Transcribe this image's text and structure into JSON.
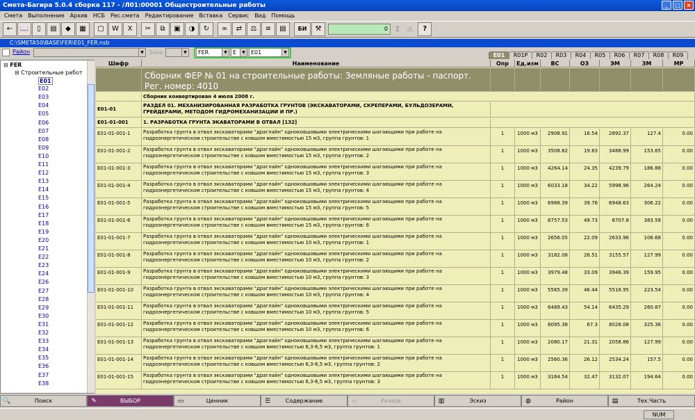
{
  "window": {
    "title": "Смета-Багира 5.0.4 сборка 117     -     /Л01:00001 Общестроительные работы"
  },
  "menu": [
    "Смета",
    "Выполнение",
    "Архив",
    "НСБ",
    "Рес.смета",
    "Редактирование",
    "Вставка",
    "Сервис",
    "Вид",
    "Помощь"
  ],
  "toolbar": {
    "bi_label": "БИ",
    "value": "0",
    "sigma": "Σ",
    "warn": "⚠"
  },
  "path": "C:\\SMETA50\\BASE\\FER\\E01_FER.nsb",
  "filters": {
    "raion": "Район",
    "zona": "Зона",
    "base": "FER",
    "letter": "E",
    "collection": "E01"
  },
  "tabs": [
    "E01",
    "R01P",
    "R02",
    "R03",
    "R04",
    "R05",
    "R06",
    "R07",
    "R08",
    "R09"
  ],
  "tree": {
    "root": "FER",
    "group": "Строительные работ",
    "codes": [
      "E01",
      "E02",
      "E03",
      "E04",
      "E05",
      "E06",
      "E07",
      "E08",
      "E09",
      "E10",
      "E11",
      "E12",
      "E13",
      "E14",
      "E15",
      "E16",
      "E17",
      "E18",
      "E19",
      "E20",
      "E21",
      "E22",
      "E23",
      "E24",
      "E26",
      "E27",
      "E28",
      "E29",
      "E30",
      "E31",
      "E32",
      "E33",
      "E34",
      "E35",
      "E36",
      "E37",
      "E38"
    ]
  },
  "columns": {
    "code": "Шифр",
    "name": "Наименование",
    "opr": "Опр",
    "unit": "Ед.изм",
    "vs": "ВС",
    "oz": "ОЗ",
    "em": "ЭМ",
    "zm": "ЗМ",
    "mr": "МР"
  },
  "header_rows": {
    "collection": "Сборник ФЕР № 01 на строительные работы: Земляные работы - паспорт. Рег. номер: 4010",
    "converted": "Сборник конвертирован 4 июля 2008 г.",
    "section_code": "E01-01",
    "section_name": "РАЗДЕЛ 01. МЕХАНИЗИРОВАННАЯ РАЗРАБОТКА ГРУНТОВ (ЭКСКАВАТОРАМИ, СКРЕПЕРАМИ, БУЛЬДОЗЕРАМИ, ГРЕЙДЕРАМИ, МЕТОДОМ ГИДРОМЕХАНИЗАЦИИ И ПР.)",
    "sub_code": "E01-01-001",
    "sub_name": "1. РАЗРАБОТКА ГРУНТА ЭКАВАТОРАМИ В ОТВАЛ [132]"
  },
  "rows": [
    {
      "code": "E01-01-001-1",
      "name": "Разработка грунта в отвал экскаваторами \"драглайн\" одноковшовыми электрическими шагающими при работе на гидроэнергетическом строительстве с ковшом вместимостью 15 м3, группа грунтов: 1",
      "opr": "1",
      "unit": "1000 м3",
      "vs": "2908.91",
      "oz": "16.54",
      "em": "2892.37",
      "zm": "127.4",
      "mr": "0.00"
    },
    {
      "code": "E01-01-001-2",
      "name": "Разработка грунта в отвал экскаваторами \"драглайн\" одноковшовыми электрическими шагающими при работе на гидроэнергетическом строительстве с ковшом вместимостью 15 м3, группа грунтов: 2",
      "opr": "1",
      "unit": "1000 м3",
      "vs": "3508.82",
      "oz": "19.83",
      "em": "3488.99",
      "zm": "153.65",
      "mr": "0.00"
    },
    {
      "code": "E01-01-001-3",
      "name": "Разработка грунта в отвал экскаваторами \"драглайн\" одноковшовыми электрическими шагающими при работе на гидроэнергетическом строительстве с ковшом вместимостью 15 м3, группа грунтов: 3",
      "opr": "1",
      "unit": "1000 м3",
      "vs": "4264.14",
      "oz": "24.35",
      "em": "4239.79",
      "zm": "186.88",
      "mr": "0.00"
    },
    {
      "code": "E01-01-001-4",
      "name": "Разработка грунта в отвал экскаваторами \"драглайн\" одноковшовыми электрическими шагающими при работе на гидроэнергетическом строительстве с ковшом вместимостью 15 м3, группа грунтов: 4",
      "opr": "1",
      "unit": "1000 м3",
      "vs": "6033.18",
      "oz": "34.22",
      "em": "5998.96",
      "zm": "264.24",
      "mr": "0.00"
    },
    {
      "code": "E01-01-001-5",
      "name": "Разработка грунта в отвал экскаваторами \"драглайн\" одноковшовыми электрическими шагающими при работе на гидроэнергетическом строительстве с ковшом вместимостью 15 м3, группа грунтов: 5",
      "opr": "1",
      "unit": "1000 м3",
      "vs": "6988.39",
      "oz": "39.76",
      "em": "6948.63",
      "zm": "306.22",
      "mr": "0.00"
    },
    {
      "code": "E01-01-001-6",
      "name": "Разработка грунта в отвал экскаваторами \"драглайн\" одноковшовыми электрическими шагающими при работе на гидроэнергетическом строительстве с ковшом вместимостью 15 м3, группа грунтов: 6",
      "opr": "1",
      "unit": "1000 м3",
      "vs": "8757.53",
      "oz": "49.73",
      "em": "8707.8",
      "zm": "383.58",
      "mr": "0.00"
    },
    {
      "code": "E01-01-001-7",
      "name": "Разработка грунта в отвал экскаваторами \"драглайн\" одноковшовыми электрическими шагающими при работе на гидроэнергетическом строительстве с ковшом вместимостью 10 м3, группа грунтов: 1",
      "opr": "1",
      "unit": "1000 м3",
      "vs": "2656.05",
      "oz": "22.09",
      "em": "2633.96",
      "zm": "106.68",
      "mr": "0.00"
    },
    {
      "code": "E01-01-001-8",
      "name": "Разработка грунта в отвал экскаваторами \"драглайн\" одноковшовыми электрическими шагающими при работе на гидроэнергетическом строительстве с ковшом вместимостью 10 м3, группа грунтов: 2",
      "opr": "1",
      "unit": "1000 м3",
      "vs": "3182.08",
      "oz": "26.51",
      "em": "3155.57",
      "zm": "127.99",
      "mr": "0.00"
    },
    {
      "code": "E01-01-001-9",
      "name": "Разработка грунта в отвал экскаваторами \"драглайн\" одноковшовыми электрическими шагающими при работе на гидроэнергетическом строительстве с ковшом вместимостью 10 м3, группа грунтов: 3",
      "opr": "1",
      "unit": "1000 м3",
      "vs": "3979.48",
      "oz": "33.09",
      "em": "3946.39",
      "zm": "159.95",
      "mr": "0.00"
    },
    {
      "code": "E01-01-001-10",
      "name": "Разработка грунта в отвал экскаваторами \"драглайн\" одноковшовыми электрическими шагающими при работе на гидроэнергетическом строительстве с ковшом вместимостью 10 м3, группа грунтов: 4",
      "opr": "1",
      "unit": "1000 м3",
      "vs": "5565.39",
      "oz": "46.44",
      "em": "5518.95",
      "zm": "223.54",
      "mr": "0.00"
    },
    {
      "code": "E01-01-001-11",
      "name": "Разработка грунта в отвал экскаваторами \"драглайн\" одноковшовыми электрическими шагающими при работе на гидроэнергетическом строительстве с ковшом вместимостью 10 м3, группа грунтов: 5",
      "opr": "1",
      "unit": "1000 м3",
      "vs": "6489.43",
      "oz": "54.14",
      "em": "6435.29",
      "zm": "260.87",
      "mr": "0.00"
    },
    {
      "code": "E01-01-001-12",
      "name": "Разработка грунта в отвал экскаваторами \"драглайн\" одноковшовыми электрическими шагающими при работе на гидроэнергетическом строительстве с ковшом вместимостью 10 м3, группа грунтов: 6",
      "opr": "1",
      "unit": "1000 м3",
      "vs": "8095.38",
      "oz": "67.3",
      "em": "8028.08",
      "zm": "325.36",
      "mr": "0.00"
    },
    {
      "code": "E01-01-001-13",
      "name": "Разработка грунта в отвал экскаваторами \"драглайн\" одноковшовыми электрическими шагающими при работе на гидроэнергетическом строительстве с ковшом вместимостью 6,3-6,5 м3, группа грунтов: 1",
      "opr": "1",
      "unit": "1000 м3",
      "vs": "2080.17",
      "oz": "21.31",
      "em": "2058.86",
      "zm": "127.99",
      "mr": "0.00"
    },
    {
      "code": "E01-01-001-14",
      "name": "Разработка грунта в отвал экскаваторами \"драглайн\" одноковшовыми электрическими шагающими при работе на гидроэнергетическом строительстве с ковшом вместимостью 6,3-6,5 м3, группа грунтов: 2",
      "opr": "1",
      "unit": "1000 м3",
      "vs": "2560.36",
      "oz": "26.12",
      "em": "2534.24",
      "zm": "157.5",
      "mr": "0.00"
    },
    {
      "code": "E01-01-001-15",
      "name": "Разработка грунта в отвал экскаваторами \"драглайн\" одноковшовыми электрическими шагающими при работе на гидроэнергетическом строительстве с ковшом вместимостью 6,3-6,5 м3, группа грунтов: 3",
      "opr": "1",
      "unit": "1000 м3",
      "vs": "3164.54",
      "oz": "32.47",
      "em": "3132.07",
      "zm": "194.64",
      "mr": "0.00"
    }
  ],
  "bottom_buttons": [
    "Поиск",
    "ВЫБОР",
    "Ценник",
    "Содержание",
    "Резерв",
    "Эскиз",
    "Район",
    "Тех.Часть"
  ],
  "status": {
    "num": "NUM"
  },
  "colors": {
    "grid_bg": "#eeeeb8",
    "header_bg": "#8f8f6a",
    "title_bg": "#0a5be0",
    "active_button": "#7a3b6a"
  }
}
